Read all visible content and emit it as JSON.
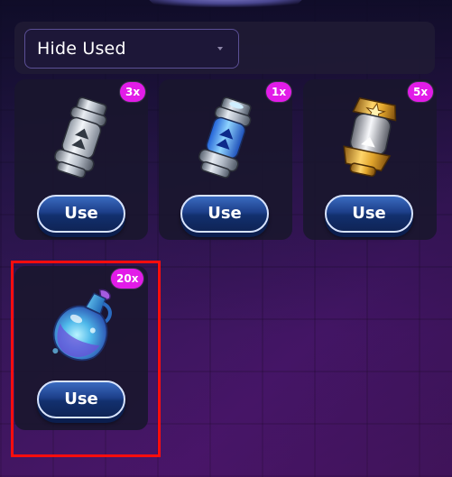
{
  "filter": {
    "selected": "Hide Used"
  },
  "items": [
    {
      "name": "Silver Capsule",
      "count": "3x",
      "use_label": "Use",
      "icon": "silver-capsule-icon"
    },
    {
      "name": "Blue Capsule",
      "count": "1x",
      "use_label": "Use",
      "icon": "blue-capsule-icon"
    },
    {
      "name": "Gold Capsule",
      "count": "5x",
      "use_label": "Use",
      "icon": "gold-capsule-icon"
    },
    {
      "name": "Potion",
      "count": "20x",
      "use_label": "Use",
      "icon": "potion-bottle-icon"
    }
  ],
  "colors": {
    "badge": "#e21ce8",
    "button": "#1d3f8a",
    "highlight": "#ff0d0d"
  }
}
